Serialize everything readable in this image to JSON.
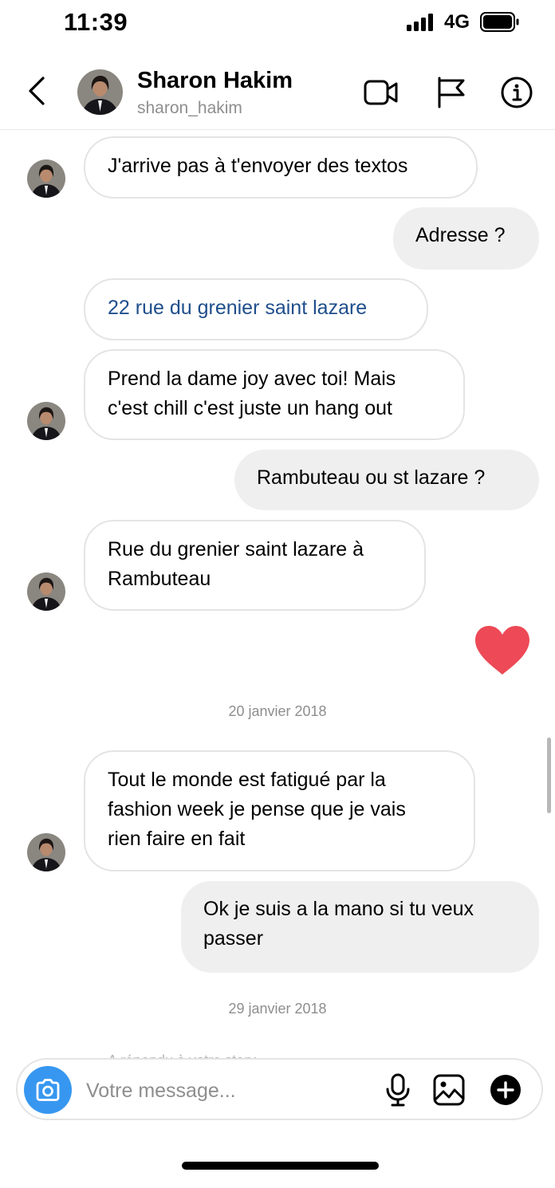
{
  "status_bar": {
    "time": "11:39",
    "network": "4G"
  },
  "header": {
    "name": "Sharon Hakim",
    "username": "sharon_hakim",
    "icons": [
      "back-icon",
      "video-call-icon",
      "flag-icon",
      "info-icon"
    ]
  },
  "messages": [
    {
      "from": "them",
      "text": "J'arrive pas à t'envoyer des textos"
    },
    {
      "from": "me",
      "text": "Adresse ?"
    },
    {
      "from": "them",
      "text": "22 rue du grenier saint lazare",
      "is_link": true
    },
    {
      "from": "them",
      "line1": "Prend la dame joy avec toi! Mais",
      "line2": "c'est chill c'est juste un hang out"
    },
    {
      "from": "me",
      "text": "Rambuteau ou st lazare ?"
    },
    {
      "from": "them",
      "line1": "Rue du grenier saint lazare à",
      "line2": "Rambuteau"
    },
    {
      "from": "me",
      "type": "heart",
      "icon": "heart-icon"
    },
    {
      "from": "them",
      "line1": "Tout le monde est fatigué par la",
      "line2": "fashion week je pense que je vais",
      "line3": "rien faire en fait"
    },
    {
      "from": "me",
      "line1": "Ok je suis a la mano si tu veux",
      "line2": "passer"
    }
  ],
  "dates": [
    "20 janvier 2018",
    "29 janvier 2018"
  ],
  "partial_text": "A répondu à votre story",
  "composer": {
    "placeholder": "Votre message...",
    "icons": [
      "camera-icon",
      "microphone-icon",
      "gallery-icon",
      "add-icon"
    ]
  },
  "colors": {
    "link": "#1f4e8c",
    "camera_button": "#3797f0",
    "heart": "#ed4956",
    "sent_bubble": "#efefef",
    "received_border": "#e4e4e4",
    "secondary_text": "#8e8e8e"
  }
}
